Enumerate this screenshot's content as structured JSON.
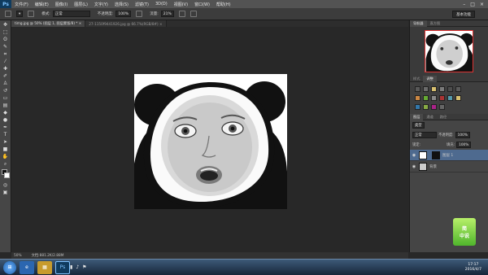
{
  "app": {
    "logo": "Ps"
  },
  "menubar": {
    "items": [
      "文件(F)",
      "编辑(E)",
      "图像(I)",
      "图层(L)",
      "文字(Y)",
      "选择(S)",
      "滤镜(T)",
      "3D(D)",
      "视图(V)",
      "窗口(W)",
      "帮助(H)"
    ],
    "win_controls": [
      "–",
      "□",
      "×"
    ]
  },
  "options": {
    "mode_label": "模式:",
    "mode_value": "正常",
    "opacity_label": "不透明度:",
    "opacity_value": "100%",
    "flow_label": "流量:",
    "flow_value": "21%",
    "workspace_button": "基本功能"
  },
  "tabs": [
    {
      "label": "timg.jpg @ 50% (图层 1, 图层蒙版/8) * ×",
      "active": true
    },
    {
      "label": "27-1150f9441926.jpg @ 66.7%(RGB/8#) ×",
      "active": false
    }
  ],
  "panels": {
    "navigator_tabs": [
      "导航器",
      "直方图"
    ],
    "adjust_tabs": [
      "样式",
      "调整"
    ],
    "layers_tabs": [
      "图层",
      "通道",
      "路径"
    ],
    "layers_filter": "类型",
    "layers_blend": "正常",
    "layers_opacity_label": "不透明度:",
    "layers_opacity_value": "100%",
    "lock_label": "锁定:",
    "fill_label": "填充:",
    "fill_value": "100%",
    "layers": [
      {
        "name": "图层 1",
        "selected": true
      },
      {
        "name": "背景",
        "selected": false
      }
    ]
  },
  "status": {
    "zoom": "50%",
    "doc": "文档:881.2K/2.88M"
  },
  "taskbar": {
    "time": "17:17",
    "date": "2016/4/7"
  },
  "watermark": {
    "text": "简\n中说"
  },
  "colors": {
    "panel_bg": "#454545",
    "canvas_bg": "#282828",
    "selected_layer": "#4e6a8f"
  }
}
